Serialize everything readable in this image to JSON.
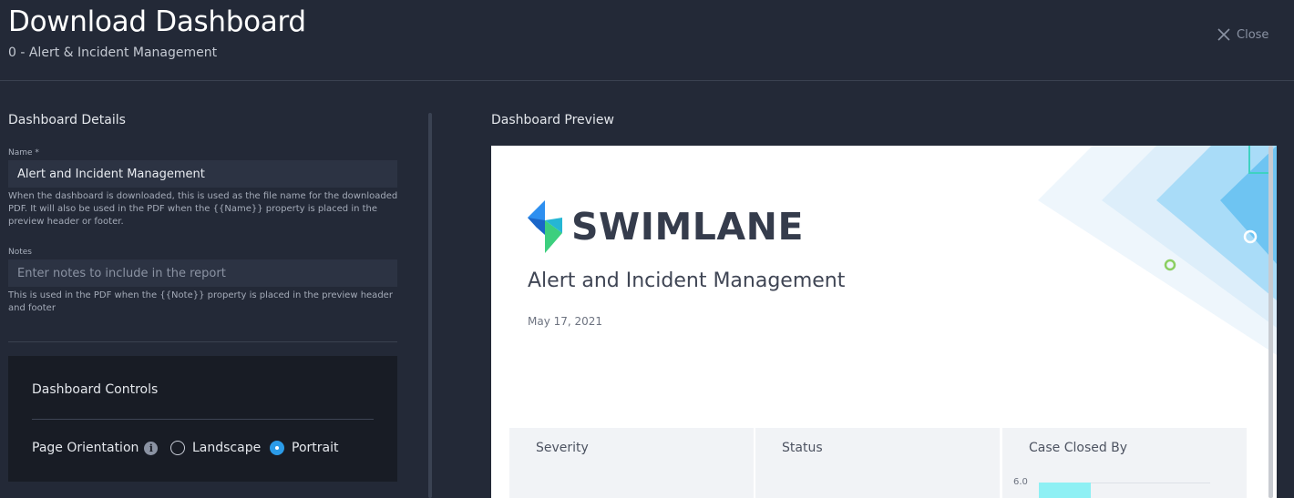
{
  "header": {
    "title": "Download Dashboard",
    "subtitle": "0 - Alert & Incident Management",
    "close_label": "Close"
  },
  "details": {
    "section_title": "Dashboard Details",
    "name_label": "Name *",
    "name_value": "Alert and Incident Management",
    "name_help": "When the dashboard is downloaded, this is used as the file name for the downloaded PDF. It will also be used in the PDF when the {{Name}} property is placed in the preview header or footer.",
    "notes_label": "Notes",
    "notes_placeholder": "Enter notes to include in the report",
    "notes_help": "This is used in the PDF when the {{Note}} property is placed in the preview header and footer"
  },
  "controls": {
    "title": "Dashboard Controls",
    "orientation_label": "Page Orientation",
    "options": [
      "Landscape",
      "Portrait"
    ],
    "selected": "Portrait"
  },
  "preview": {
    "section_title": "Dashboard Preview",
    "logo_text": "SWIMLANE",
    "report_title": "Alert and Incident Management",
    "report_date": "May 17, 2021",
    "widgets": [
      {
        "title": "Severity"
      },
      {
        "title": "Status"
      },
      {
        "title": "Case Closed By",
        "tick": "6.0"
      }
    ]
  },
  "colors": {
    "background": "#232937",
    "accent": "#2b9be8",
    "brand_green": "#3ccf7e",
    "brand_blue": "#2d8ff0"
  }
}
